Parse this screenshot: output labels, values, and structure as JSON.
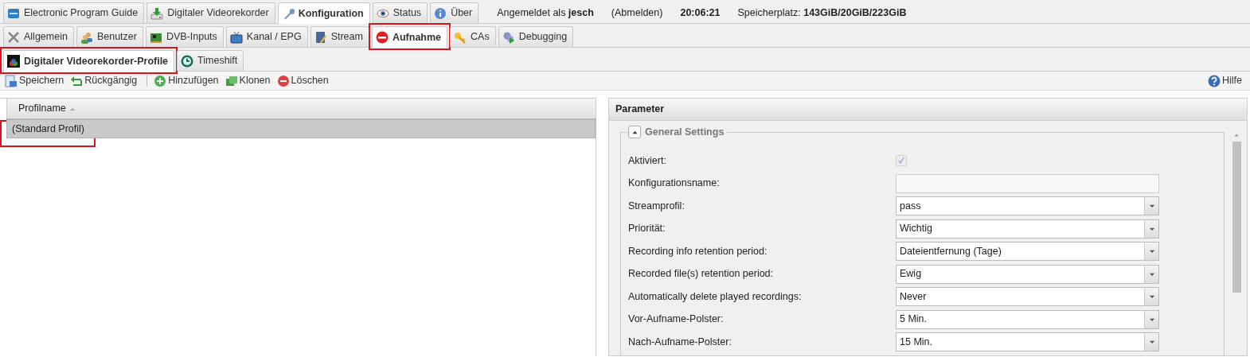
{
  "main_tabs": [
    {
      "label": "Electronic Program Guide",
      "selected": false
    },
    {
      "label": "Digitaler Videorekorder",
      "selected": false
    },
    {
      "label": "Konfiguration",
      "selected": true
    },
    {
      "label": "Status",
      "selected": false
    },
    {
      "label": "Über",
      "selected": false
    }
  ],
  "header": {
    "user_prefix": "Angemeldet als",
    "user": "jesch",
    "logout": "(Abmelden)",
    "time": "20:06:21",
    "storage_label": "Speicherplatz:",
    "storage": "143GiB/20GiB/223GiB"
  },
  "config_tabs": [
    {
      "label": "Allgemein",
      "selected": false,
      "highlighted": false
    },
    {
      "label": "Benutzer",
      "selected": false,
      "highlighted": false
    },
    {
      "label": "DVB-Inputs",
      "selected": false,
      "highlighted": false
    },
    {
      "label": "Kanal / EPG",
      "selected": false,
      "highlighted": false
    },
    {
      "label": "Stream",
      "selected": false,
      "highlighted": false
    },
    {
      "label": "Aufnahme",
      "selected": true,
      "highlighted": true
    },
    {
      "label": "CAs",
      "selected": false,
      "highlighted": false
    },
    {
      "label": "Debugging",
      "selected": false,
      "highlighted": false
    }
  ],
  "sub_tabs": [
    {
      "label": "Digitaler Videorekorder-Profile",
      "selected": true,
      "highlighted": true
    },
    {
      "label": "Timeshift",
      "selected": false,
      "highlighted": false
    }
  ],
  "toolbar": {
    "groups": [
      [
        {
          "label": "Speichern"
        },
        {
          "label": "Rückgängig"
        }
      ],
      [
        {
          "label": "Hinzufügen"
        },
        {
          "label": "Klonen"
        },
        {
          "label": "Löschen"
        }
      ]
    ],
    "help": "Hilfe"
  },
  "grid": {
    "column": "Profilname",
    "rows": [
      {
        "name": "(Standard Profil)",
        "selected": true,
        "highlighted": true
      }
    ]
  },
  "parameter": {
    "title": "Parameter",
    "section": {
      "title": "General Settings",
      "expanded": true,
      "fields": [
        {
          "kind": "checkbox",
          "label": "Aktiviert:",
          "checked": true,
          "disabled": true
        },
        {
          "kind": "text",
          "label": "Konfigurationsname:",
          "disabled": true
        },
        {
          "kind": "select",
          "label": "Streamprofil:",
          "value": "pass"
        },
        {
          "kind": "select",
          "label": "Priorität:",
          "value": "Wichtig"
        },
        {
          "kind": "select",
          "label": "Recording info retention period:",
          "value": "Dateientfernung (Tage)"
        },
        {
          "kind": "select",
          "label": "Recorded file(s) retention period:",
          "value": "Ewig"
        },
        {
          "kind": "select",
          "label": "Automatically delete played recordings:",
          "value": "Never"
        },
        {
          "kind": "select",
          "label": "Vor-Aufname-Polster:",
          "value": "5 Min."
        },
        {
          "kind": "select",
          "label": "Nach-Aufname-Polster:",
          "value": "15 Min."
        }
      ]
    }
  }
}
